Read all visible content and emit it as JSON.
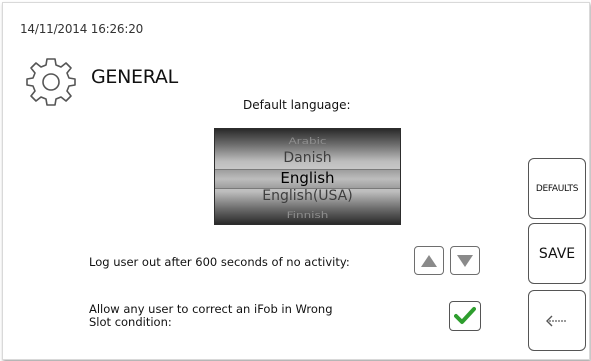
{
  "status": {
    "timestamp": "14/11/2014 16:26:20"
  },
  "header": {
    "title": "GENERAL",
    "icon": "gear-icon"
  },
  "language": {
    "label": "Default language:",
    "options": [
      "Arabic",
      "Danish",
      "English",
      "English(USA)",
      "Finnish"
    ],
    "selected": "English"
  },
  "settings": {
    "logout_text": "Log user out after 600 seconds of no activity:",
    "ifob_text": "Allow any user to correct an iFob in Wrong Slot condition:",
    "ifob_checked": true
  },
  "actions": {
    "defaults_label": "DEFAULTS",
    "save_label": "SAVE",
    "back_icon": "back-arrow-icon"
  },
  "colors": {
    "check": "#2e9e2e",
    "icon_stroke": "#555555"
  }
}
